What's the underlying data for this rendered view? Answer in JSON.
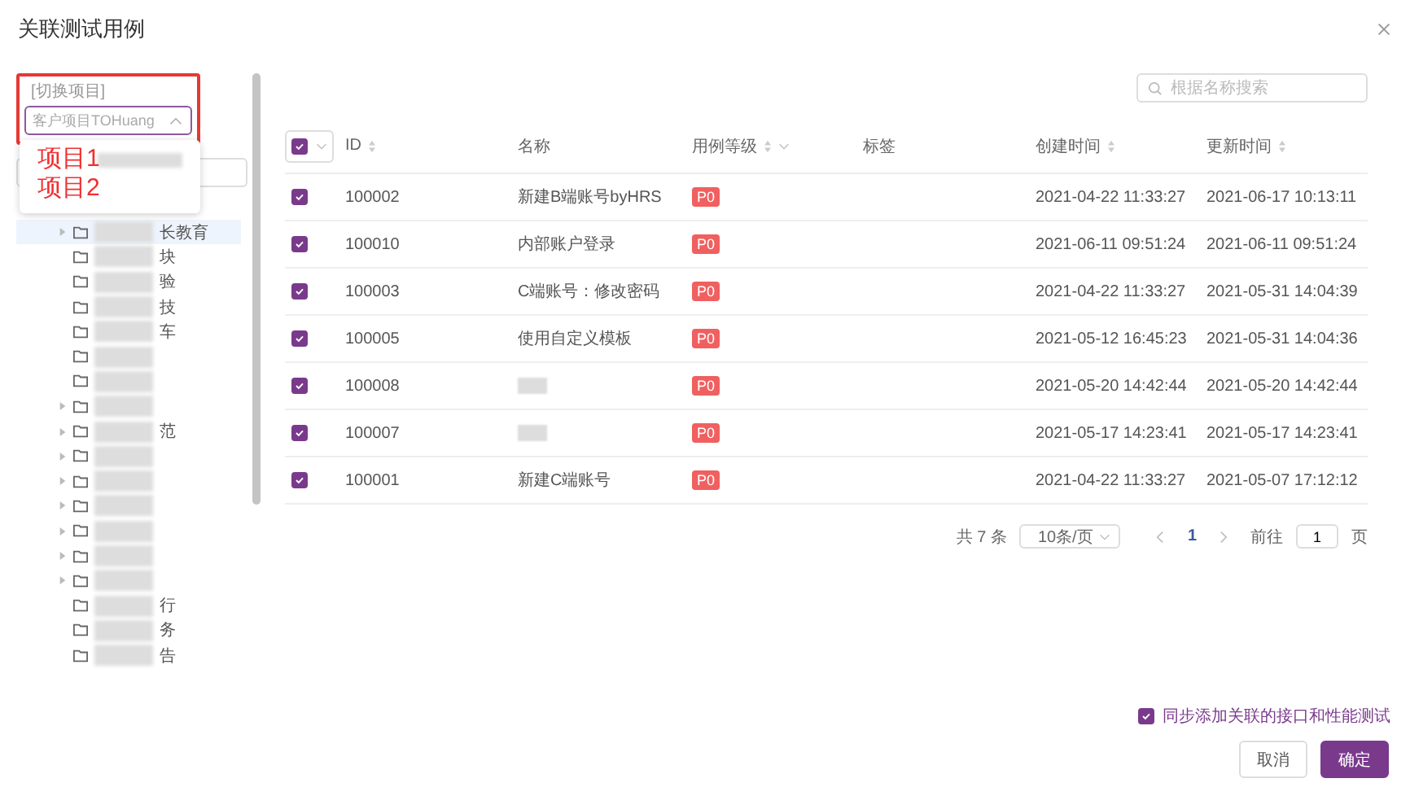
{
  "dialog": {
    "title": "关联测试用例"
  },
  "project_switch": {
    "label": "[切换项目]",
    "value": "客户项目TOHuang",
    "expanded": true
  },
  "annotation": {
    "options": [
      "项目1",
      "项目2"
    ]
  },
  "tree": {
    "items": [
      {
        "label": "长教育",
        "has_children": true,
        "selected": true
      },
      {
        "label": "块",
        "has_children": false,
        "selected": false
      },
      {
        "label": "验",
        "has_children": false,
        "selected": false
      },
      {
        "label": "技",
        "has_children": false,
        "selected": false
      },
      {
        "label": "车",
        "has_children": false,
        "selected": false
      },
      {
        "has_children": false,
        "selected": false
      },
      {
        "has_children": false,
        "selected": false
      },
      {
        "has_children": true,
        "selected": false
      },
      {
        "label": "范",
        "has_children": true,
        "selected": false
      },
      {
        "has_children": true,
        "selected": false
      },
      {
        "has_children": true,
        "selected": false
      },
      {
        "has_children": true,
        "selected": false
      },
      {
        "has_children": true,
        "selected": false
      },
      {
        "has_children": true,
        "selected": false
      },
      {
        "has_children": true,
        "selected": false
      },
      {
        "label": "行",
        "has_children": false,
        "selected": false
      },
      {
        "label": "务",
        "has_children": false,
        "selected": false
      },
      {
        "label": "告",
        "has_children": false,
        "selected": false
      }
    ]
  },
  "search": {
    "placeholder": "根据名称搜索"
  },
  "table": {
    "all_checked": true,
    "columns": [
      {
        "label": "ID",
        "sortable": true,
        "filter": false
      },
      {
        "label": "名称",
        "sortable": false,
        "filter": false
      },
      {
        "label": "用例等级",
        "sortable": true,
        "filter": true
      },
      {
        "label": "标签",
        "sortable": false,
        "filter": false
      },
      {
        "label": "创建时间",
        "sortable": true,
        "filter": false
      },
      {
        "label": "更新时间",
        "sortable": true,
        "filter": false
      }
    ],
    "rows": [
      {
        "checked": true,
        "id": "100002",
        "name": "新建B端账号byHRS",
        "level": "P0",
        "created": "2021-04-22 11:33:27",
        "updated": "2021-06-17 10:13:11"
      },
      {
        "checked": true,
        "id": "100010",
        "name": "内部账户登录",
        "level": "P0",
        "created": "2021-06-11 09:51:24",
        "updated": "2021-06-11 09:51:24"
      },
      {
        "checked": true,
        "id": "100003",
        "name": "C端账号：修改密码",
        "level": "P0",
        "created": "2021-04-22 11:33:27",
        "updated": "2021-05-31 14:04:39"
      },
      {
        "checked": true,
        "id": "100005",
        "name": "使用自定义模板",
        "level": "P0",
        "created": "2021-05-12 16:45:23",
        "updated": "2021-05-31 14:04:36"
      },
      {
        "checked": true,
        "id": "100008",
        "level": "P0",
        "created": "2021-05-20 14:42:44",
        "updated": "2021-05-20 14:42:44"
      },
      {
        "checked": true,
        "id": "100007",
        "level": "P0",
        "created": "2021-05-17 14:23:41",
        "updated": "2021-05-17 14:23:41"
      },
      {
        "checked": true,
        "id": "100001",
        "name": "新建C端账号",
        "level": "P0",
        "created": "2021-04-22 11:33:27",
        "updated": "2021-05-07 17:12:12"
      }
    ]
  },
  "pagination": {
    "total": "共 7 条",
    "page_size": "10条/页",
    "pages": [
      {
        "label": "1",
        "selected": true
      }
    ],
    "goto_label": "前往",
    "goto_value": "1",
    "goto_suffix": "页"
  },
  "sync_option": {
    "label": "同步添加关联的接口和性能测试",
    "checked": true
  },
  "buttons": [
    {
      "label": "取消",
      "kind": "secondary"
    },
    {
      "label": "确定",
      "kind": "primary"
    }
  ]
}
